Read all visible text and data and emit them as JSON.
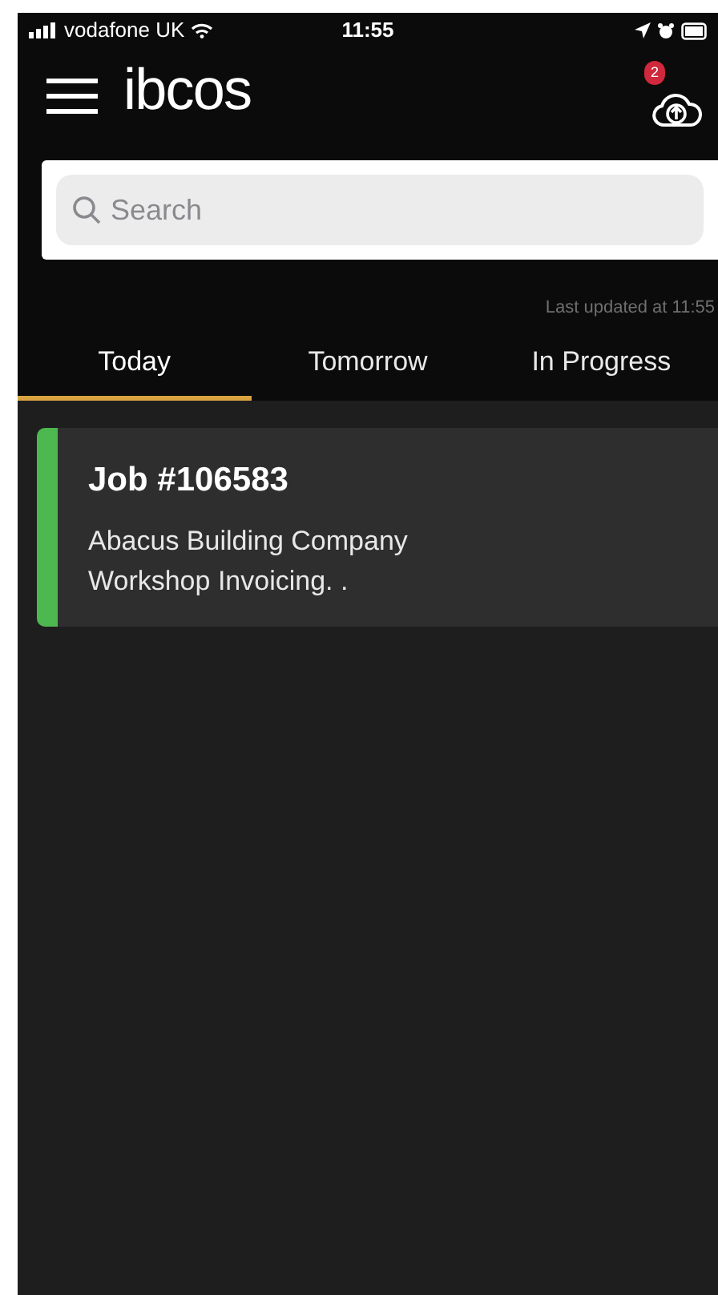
{
  "status_bar": {
    "carrier": "vodafone UK",
    "time": "11:55"
  },
  "header": {
    "logo": "ibcos",
    "upload_badge": "2"
  },
  "search": {
    "placeholder": "Search"
  },
  "last_updated": "Last updated at 11:55",
  "tabs": [
    {
      "label": "Today",
      "selected": true
    },
    {
      "label": "Tomorrow",
      "selected": false
    },
    {
      "label": "In Progress",
      "selected": false
    }
  ],
  "jobs": [
    {
      "title": "Job #106583",
      "customer": "Abacus Building Company",
      "description": "Workshop Invoicing. .",
      "color": "#4cb84f"
    }
  ]
}
